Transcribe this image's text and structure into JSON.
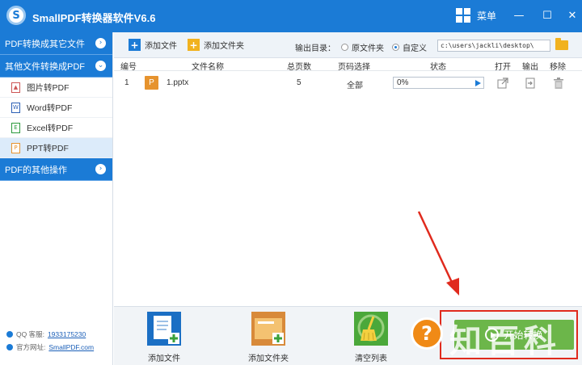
{
  "app": {
    "title": "SmallPDF转换器软件V6.6",
    "logo_letter": "S"
  },
  "titlebar": {
    "menu_label": "菜单",
    "min_glyph": "—",
    "max_glyph": "☐",
    "close_glyph": "✕"
  },
  "sidebar": {
    "sections": [
      {
        "label": "PDF转换成其它文件",
        "chevron": "›"
      },
      {
        "label": "其他文件转换成PDF",
        "chevron": "⌄"
      },
      {
        "label": "PDF的其他操作",
        "chevron": "›"
      }
    ],
    "items": [
      {
        "label": "图片转PDF",
        "icon": "image-file-icon"
      },
      {
        "label": "Word转PDF",
        "icon": "word-file-icon"
      },
      {
        "label": "Excel转PDF",
        "icon": "excel-file-icon"
      },
      {
        "label": "PPT转PDF",
        "icon": "ppt-file-icon",
        "active": true
      }
    ],
    "qq_label": "QQ 客服:",
    "qq_number": "1933175230",
    "site_label": "官方网址:",
    "site_url": "SmallPDF.com"
  },
  "toolbar": {
    "add_file": "添加文件",
    "add_folder": "添加文件夹",
    "output_label": "输出目录：",
    "radio_source": "原文件夹",
    "radio_custom": "自定义",
    "output_path": "c:\\users\\jackli\\desktop\\"
  },
  "table": {
    "headers": [
      "编号",
      "文件名称",
      "总页数",
      "页码选择",
      "状态",
      "打开",
      "输出",
      "移除"
    ],
    "rows": [
      {
        "index": "1",
        "icon_letter": "P",
        "name": "1.pptx",
        "pages": "5",
        "page_select": "全部",
        "progress_text": "0%",
        "progress": 0.0
      }
    ]
  },
  "bottom": {
    "add_file": "添加文件",
    "add_folder": "添加文件夹",
    "clear_list": "清空列表",
    "start": "开始转换"
  },
  "watermark": {
    "q": "?",
    "text": "知百科"
  },
  "colors": {
    "accent": "#1b7bd6",
    "highlight": "#e02a1d",
    "start_green": "#6cb64a",
    "ppt_orange": "#e6932e"
  }
}
